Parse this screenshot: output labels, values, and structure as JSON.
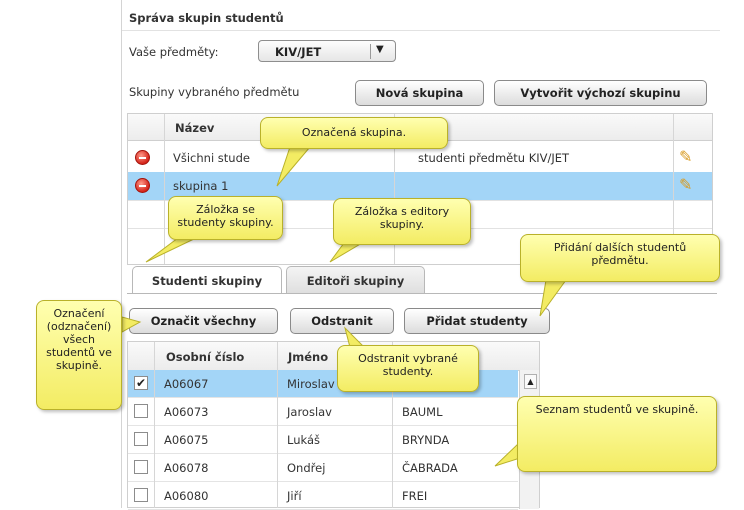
{
  "panel": {
    "title": "Správa skupin studentů",
    "subjects_label": "Vaše předměty:",
    "subject_selected": "KIV/JET",
    "groups_label": "Skupiny vybraného předmětu",
    "new_group_button": "Nová skupina",
    "default_group_button": "Vytvořit výchozí skupinu"
  },
  "groups_table": {
    "header_name": "Název",
    "rows": [
      {
        "name": "Všichni stude",
        "description": "studenti předmětu KIV/JET"
      },
      {
        "name": "skupina 1",
        "description": ""
      }
    ]
  },
  "tabs": {
    "students": "Studenti skupiny",
    "editors": "Editoři skupiny"
  },
  "actions": {
    "select_all": "Označit všechny",
    "remove": "Odstranit",
    "add_students": "Přidat studenty"
  },
  "students_table": {
    "headers": {
      "id": "Osobní číslo",
      "first": "Jméno",
      "last": ""
    },
    "rows": [
      {
        "checked": "✔",
        "id": "A06067",
        "first": "Miroslav",
        "last": ""
      },
      {
        "checked": "",
        "id": "A06073",
        "first": "Jaroslav",
        "last": "BAUML"
      },
      {
        "checked": "",
        "id": "A06075",
        "first": "Lukáš",
        "last": "BRYNDA"
      },
      {
        "checked": "",
        "id": "A06078",
        "first": "Ondřej",
        "last": "ČABRADA"
      },
      {
        "checked": "",
        "id": "A06080",
        "first": "Jiří",
        "last": "FREI"
      }
    ]
  },
  "callouts": {
    "selected_group": "Označená skupina.",
    "students_tab": "Záložka se studenty skupiny.",
    "editors_tab": "Záložka s editory skupiny.",
    "add_more": "Přidání dalších studentů předmětu.",
    "select_all": "Označení (odznačení) všech studentů ve skupině.",
    "remove_selected": "Odstranit vybrané studenty.",
    "student_list": "Seznam studentů ve skupině."
  },
  "colors": {
    "selection": "#a3d5f7",
    "callout": "#f3ec63",
    "delete_icon": "#d4241a"
  }
}
